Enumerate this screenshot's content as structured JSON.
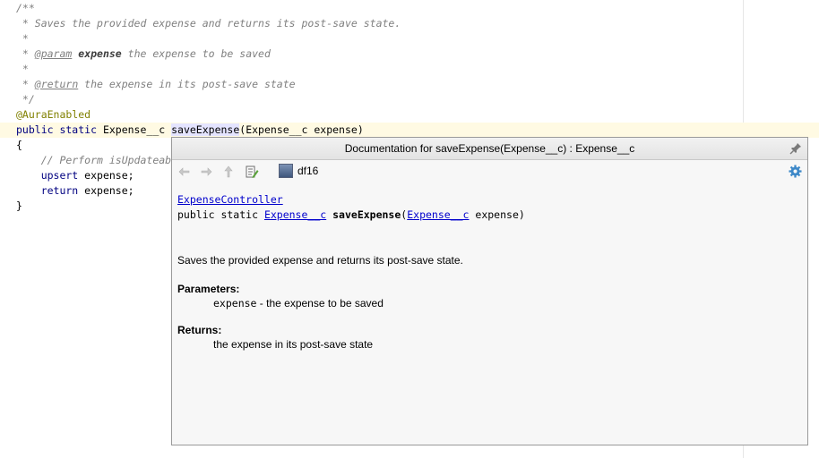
{
  "editor": {
    "lines": {
      "l0": "/**",
      "l1": " * Saves the provided expense and returns its post-save state.",
      "l2": " *",
      "l3_prefix": " * ",
      "l3_tag": "@param",
      "l3_name": "expense",
      "l3_rest": " the expense to be saved",
      "l4": " *",
      "l5_prefix": " * ",
      "l5_tag": "@return",
      "l5_rest": " the expense in its post-save state",
      "l6": " */",
      "l7": "@AuraEnabled",
      "l8_kw": "public static",
      "l8_type": " Expense__c ",
      "l8_method": "saveExpense",
      "l8_rest": "(Expense__c expense)",
      "l9": "{",
      "l10": "    // Perform isUpdateab",
      "l11_kw": "    upsert",
      "l11_rest": " expense;",
      "l12_kw": "    return",
      "l12_rest": " expense;",
      "l13": "}"
    }
  },
  "doc_popup": {
    "title": "Documentation for saveExpense(Expense__c) : Expense__c",
    "toolbar": {
      "back_icon": "arrow-left-icon",
      "forward_icon": "arrow-right-icon",
      "up_icon": "arrow-up-icon",
      "edit_source_icon": "edit-source-icon",
      "module_label": "df16",
      "settings_icon": "gear-icon",
      "pin_icon": "pin-icon"
    },
    "signature": {
      "class_link": "ExpenseController",
      "modifiers": "public static ",
      "return_type": "Expense__c",
      "method_name": "saveExpense",
      "open_paren": "(",
      "param_type": "Expense__c",
      "param_rest": " expense)"
    },
    "description": "Saves the provided expense and returns its post-save state.",
    "parameters_heading": "Parameters:",
    "parameter_name": "expense",
    "parameter_desc": " - the expense to be saved",
    "returns_heading": "Returns:",
    "returns_desc": "the expense in its post-save state"
  }
}
